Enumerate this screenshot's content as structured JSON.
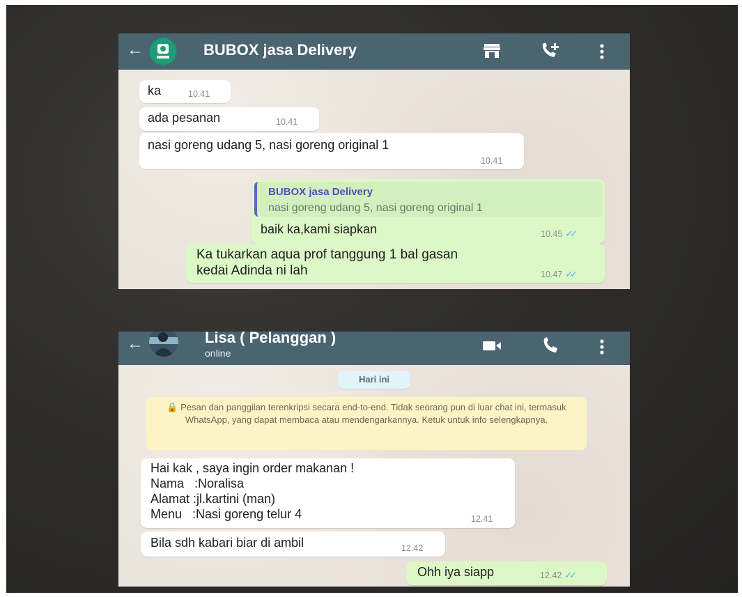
{
  "chat1": {
    "title": "BUBOX jasa Delivery",
    "back_glyph": "←",
    "messages": [
      {
        "text": "ka",
        "time": "10.41"
      },
      {
        "text": "ada pesanan",
        "time": "10.41"
      },
      {
        "text": "nasi goreng udang 5, nasi goreng original 1",
        "time": "10.41"
      }
    ],
    "reply": {
      "quote_name": "BUBOX jasa Delivery",
      "quote_text": "nasi goreng udang 5, nasi goreng original 1",
      "text": "baik ka,kami siapkan",
      "time": "10.45"
    },
    "outgoing2": {
      "line1": "Ka tukarkan aqua prof tanggung 1 bal gasan",
      "line2": "kedai Adinda ni lah",
      "time": "10.47"
    },
    "icons": [
      "store-icon",
      "add-call-icon",
      "more-icon"
    ]
  },
  "chat2": {
    "title": "Lisa ( Pelanggan )",
    "status": "online",
    "back_glyph": "←",
    "date_chip": "Hari ini",
    "encryption_notice": "🔒 Pesan dan panggilan terenkripsi secara end-to-end. Tidak seorang pun di luar chat ini, termasuk WhatsApp, yang dapat membaca atau mendengarkannya. Ketuk untuk info selengkapnya.",
    "order": {
      "line1": "Hai kak , saya ingin order makanan !",
      "line2": "Nama   :Noralisa",
      "line3": "Alamat :jl.kartini (man)",
      "line4": "Menu   :Nasi goreng telur 4",
      "time": "12.41"
    },
    "followup": {
      "text": "Bila sdh kabari biar di ambil",
      "time": "12.42"
    },
    "answer": {
      "text": "Ohh iya siapp",
      "time": "12.42"
    },
    "icons": [
      "video-call-icon",
      "voice-call-icon",
      "more-icon"
    ]
  },
  "colors": {
    "header": "#4a6470",
    "chat_bg": "#ece5dd",
    "outgoing": "#dcf8c6",
    "tick_blue": "#4fb6ec",
    "quote_bar": "#6f5cc6"
  }
}
